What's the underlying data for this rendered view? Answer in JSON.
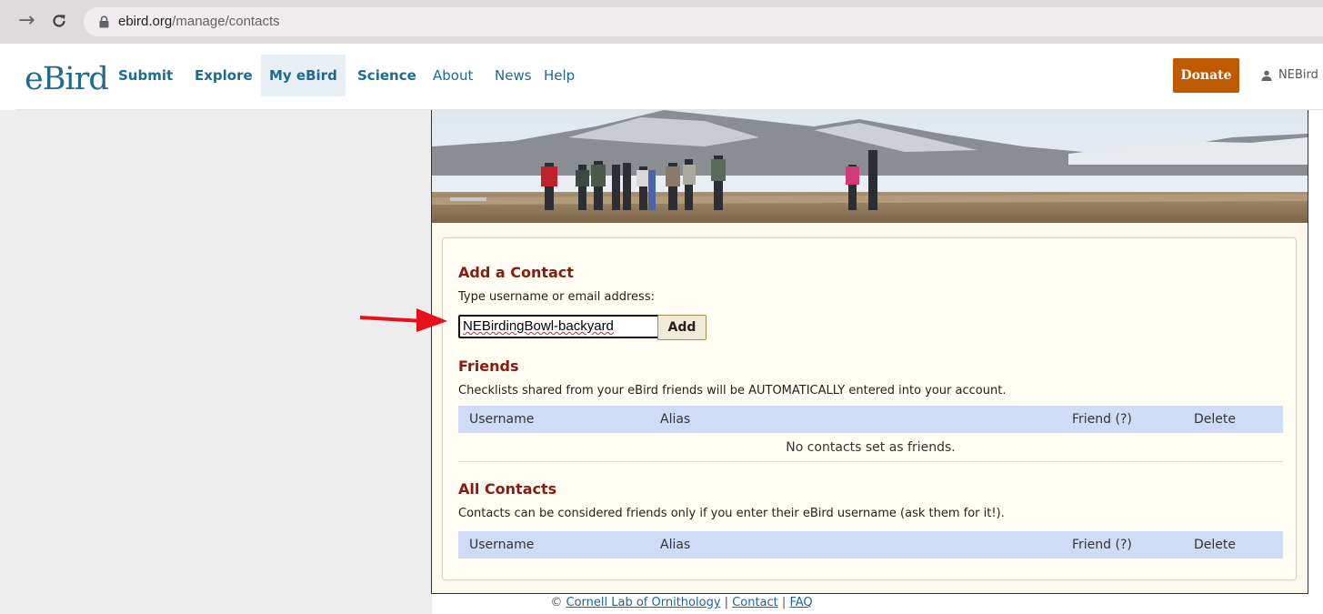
{
  "browser": {
    "url_host": "ebird.org",
    "url_path": "/manage/contacts"
  },
  "header": {
    "logo_text": "eBird",
    "nav": [
      {
        "label": "Submit"
      },
      {
        "label": "Explore"
      },
      {
        "label": "My eBird"
      },
      {
        "label": "Science"
      },
      {
        "label": "About"
      },
      {
        "label": "News"
      },
      {
        "label": "Help"
      }
    ],
    "donate_label": "Donate",
    "user_name": "NEBird"
  },
  "add_contact": {
    "title": "Add a Contact",
    "instructions": "Type username or email address:",
    "input_value": "NEBirdingBowl-backyard",
    "add_label": "Add"
  },
  "friends": {
    "title": "Friends",
    "description": "Checklists shared from your eBird friends will be AUTOMATICALLY entered into your account.",
    "columns": [
      "Username",
      "Alias",
      "Friend (?)",
      "Delete"
    ],
    "empty_text": "No contacts set as friends."
  },
  "all_contacts": {
    "title": "All Contacts",
    "description": "Contacts can be considered friends only if you enter their eBird username (ask them for it!).",
    "columns": [
      "Username",
      "Alias",
      "Friend (?)",
      "Delete"
    ]
  },
  "footer": {
    "copyright": "©",
    "links": [
      "Cornell Lab of Ornithology",
      "Contact",
      "FAQ"
    ],
    "separator": "|"
  },
  "colors": {
    "brand_blue": "#1d6a94",
    "donate": "#bf5a00",
    "section_title": "#8b1a0e",
    "table_header": "#cfdcf6",
    "annotation_arrow": "#e8101a"
  }
}
